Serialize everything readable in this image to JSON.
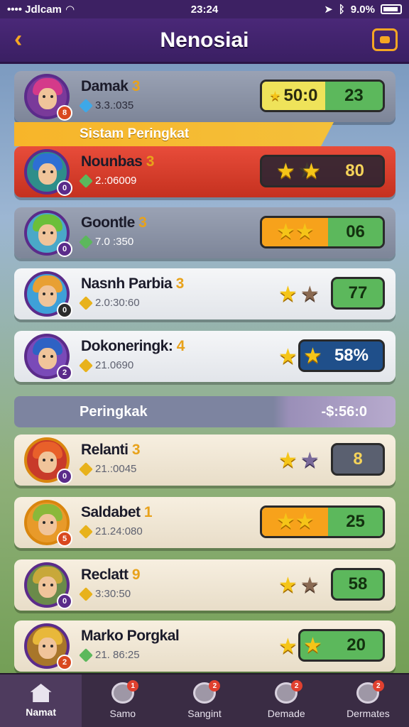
{
  "status_bar": {
    "carrier": "•••• Jdlcam",
    "time": "23:24",
    "battery": "9.0%"
  },
  "header": {
    "title": "Nenosiai",
    "back_icon": "chevron-left-icon",
    "menu_icon": "chat-icon"
  },
  "banner": {
    "text": "Sistam Peringkat"
  },
  "section": {
    "label": "Peringkak",
    "value": "-$:56:0"
  },
  "players": [
    {
      "name": "Damak",
      "rank_mark": "3",
      "score": "3.3.:035",
      "badge": "8",
      "gem": "blue",
      "stars": 0,
      "pill": [
        {
          "text": "50:0",
          "color": "yellow"
        },
        {
          "text": "23",
          "color": "green"
        }
      ]
    },
    {
      "name": "Nounbas",
      "rank_mark": "3",
      "score": "2.:06009",
      "badge": "0",
      "gem": "green",
      "stars": 2,
      "pill": [
        {
          "text": "80",
          "color": "dark"
        }
      ]
    },
    {
      "name": "Goontle",
      "rank_mark": "3",
      "score": "7.0 :350",
      "badge": "0",
      "gem": "green",
      "stars": 2,
      "pill": [
        {
          "text": "",
          "color": "orange"
        },
        {
          "text": "06",
          "color": "green"
        }
      ]
    },
    {
      "name": "Nasnh Parbia",
      "rank_mark": "3",
      "score": "2.0:30:60",
      "badge": "0",
      "gem": "gold",
      "stars": 1,
      "pill": [
        {
          "text": "77",
          "color": "green"
        }
      ]
    },
    {
      "name": "Dokoneringk:",
      "rank_mark": "4",
      "score": "21.0690",
      "badge": "2",
      "gem": "gold",
      "stars": 2,
      "pill": [
        {
          "text": "58%",
          "color": "navy"
        }
      ]
    },
    {
      "name": "Relanti",
      "rank_mark": "3",
      "score": "21.:0045",
      "badge": "0",
      "gem": "gold",
      "stars": 1,
      "pill": [
        {
          "text": "8",
          "color": "slate"
        }
      ]
    },
    {
      "name": "Saldabet",
      "rank_mark": "1",
      "score": "21.24:080",
      "badge": "5",
      "gem": "gold",
      "stars": 2,
      "pill": [
        {
          "text": "",
          "color": "orange"
        },
        {
          "text": "25",
          "color": "green"
        }
      ]
    },
    {
      "name": "Reclatt",
      "rank_mark": "9",
      "score": "3:30:50",
      "badge": "0",
      "gem": "gold",
      "stars": 1,
      "pill": [
        {
          "text": "58",
          "color": "green"
        }
      ]
    },
    {
      "name": "Marko Porgkal",
      "rank_mark": "",
      "score": "21. 86:25",
      "badge": "2",
      "gem": "green",
      "stars": 2,
      "pill": [
        {
          "text": "20",
          "color": "green"
        }
      ]
    }
  ],
  "bottom_nav": [
    {
      "label": "Namat",
      "icon": "home-icon",
      "badge": ""
    },
    {
      "label": "Samo",
      "icon": "search-icon",
      "badge": "1"
    },
    {
      "label": "Sangint",
      "icon": "target-icon",
      "badge": "2"
    },
    {
      "label": "Demade",
      "icon": "trophy-icon",
      "badge": "2"
    },
    {
      "label": "Dermates",
      "icon": "badge-icon",
      "badge": "2"
    }
  ]
}
